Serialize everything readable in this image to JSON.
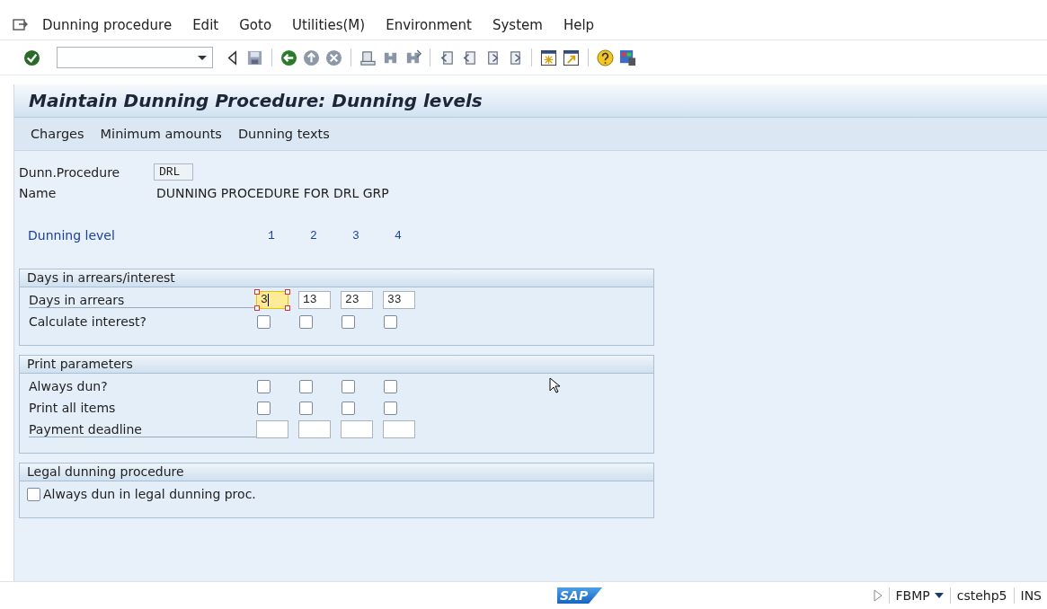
{
  "menu_bar": [
    {
      "label": "Dunning procedure"
    },
    {
      "label": "Edit"
    },
    {
      "label": "Goto"
    },
    {
      "label": "Utilities(M)"
    },
    {
      "label": "Environment"
    },
    {
      "label": "System"
    },
    {
      "label": "Help"
    }
  ],
  "title": "Maintain Dunning Procedure: Dunning levels",
  "app_toolbar": [
    {
      "label": "Charges"
    },
    {
      "label": "Minimum amounts"
    },
    {
      "label": "Dunning texts"
    }
  ],
  "header_fields": [
    {
      "kind": "input",
      "label": "Dunn.Procedure",
      "value": "DRL"
    },
    {
      "kind": "text",
      "label": "Name",
      "value": "DUNNING PROCEDURE FOR DRL GRP"
    }
  ],
  "dunning_level": {
    "label": "Dunning level",
    "levels": [
      "1",
      "2",
      "3",
      "4"
    ]
  },
  "groups": [
    {
      "title": "Days in arrears/interest",
      "rows": [
        {
          "kind": "input",
          "label": "Days in arrears",
          "cells": [
            {
              "value": "3",
              "focused": true
            },
            {
              "value": "13",
              "focused": false
            },
            {
              "value": "23",
              "focused": false
            },
            {
              "value": "33",
              "focused": false
            }
          ]
        },
        {
          "kind": "checkbox",
          "label": "Calculate interest?",
          "cells": [
            {
              "checked": false
            },
            {
              "checked": false
            },
            {
              "checked": false
            },
            {
              "checked": false
            }
          ]
        }
      ]
    },
    {
      "title": "Print parameters",
      "rows": [
        {
          "kind": "checkbox",
          "label": "Always dun?",
          "cells": [
            {
              "checked": false
            },
            {
              "checked": false
            },
            {
              "checked": false
            },
            {
              "checked": false
            }
          ]
        },
        {
          "kind": "checkbox",
          "label": "Print all items",
          "cells": [
            {
              "checked": false
            },
            {
              "checked": false
            },
            {
              "checked": false
            },
            {
              "checked": false
            }
          ]
        },
        {
          "kind": "input",
          "label": "Payment deadline",
          "cells": [
            {
              "focused": false
            },
            {
              "focused": false
            },
            {
              "focused": false
            },
            {
              "focused": false
            }
          ]
        }
      ]
    },
    {
      "title": "Legal dunning procedure",
      "rows": [
        {
          "kind": "single_checkbox",
          "label": "Always dun in legal dunning proc.",
          "checked": false
        }
      ]
    }
  ],
  "status_bar": {
    "logo": "SAP",
    "transaction": "FBMP",
    "system": "cstehp5",
    "mode": "INS"
  }
}
